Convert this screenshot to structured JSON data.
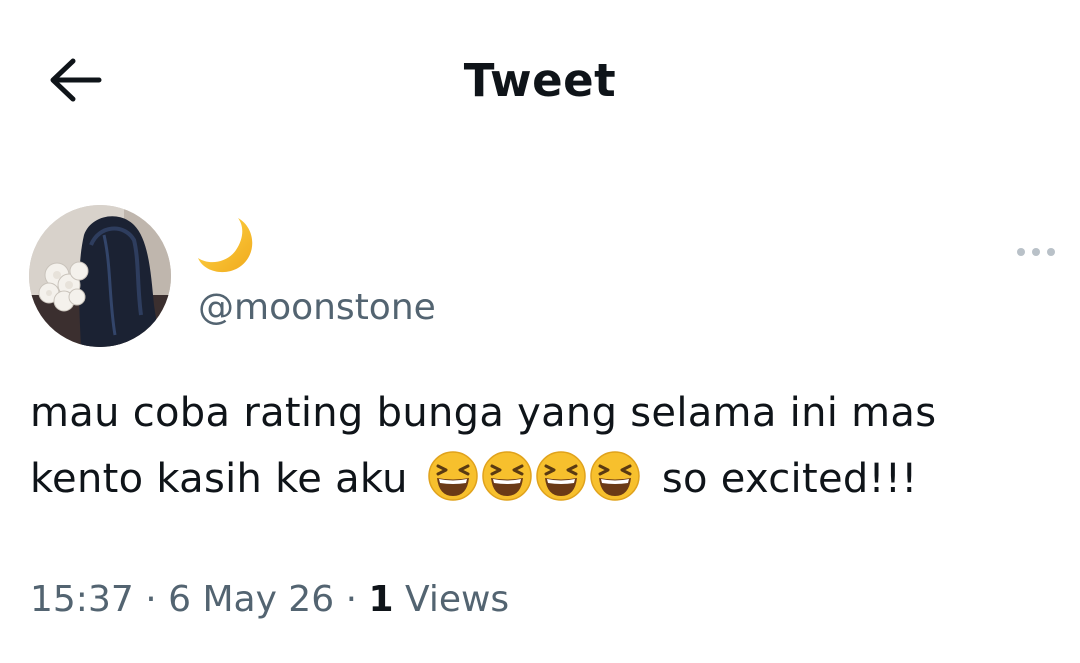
{
  "header": {
    "title": "Tweet",
    "back_icon": "arrow-left-icon"
  },
  "tweet": {
    "author": {
      "display_name_icon": "crescent-moon-emoji",
      "handle": "@moonstone"
    },
    "more_icon": "more-horizontal-icon",
    "text_line1": "mau coba rating bunga yang selama ini mas",
    "text_line2_prefix": "kento kasih ke aku",
    "emojis": [
      "grinning-squinting-face-emoji",
      "grinning-squinting-face-emoji",
      "grinning-squinting-face-emoji",
      "grinning-squinting-face-emoji"
    ],
    "text_line2_suffix": "so excited!!!",
    "meta": {
      "time": "15:37",
      "separator": " · ",
      "date": "6 May 26",
      "views_count": "1",
      "views_label": "Views"
    }
  },
  "colors": {
    "text_primary": "#0f1419",
    "text_secondary": "#536471",
    "emoji_yellow": "#f7c02d",
    "moon_yellow": "#f5c02a"
  }
}
